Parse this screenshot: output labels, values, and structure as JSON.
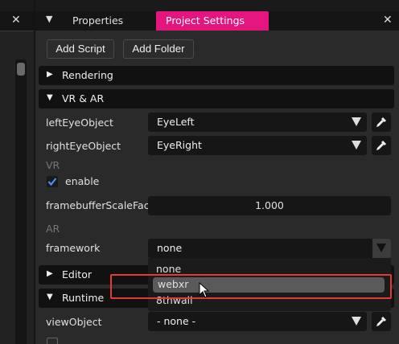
{
  "tabs": {
    "properties": "Properties",
    "project_settings": "Project Settings"
  },
  "toolbar": {
    "add_script": "Add Script",
    "add_folder": "Add Folder"
  },
  "sections": {
    "rendering": "Rendering",
    "vr_ar": "VR & AR",
    "editor": "Editor",
    "runtime": "Runtime"
  },
  "vr_ar": {
    "left_eye_label": "leftEyeObject",
    "left_eye_value": "EyeLeft",
    "right_eye_label": "rightEyeObject",
    "right_eye_value": "EyeRight",
    "vr_header": "VR",
    "enable_label": "enable",
    "enable_checked": true,
    "framebuffer_label": "framebufferScaleFactor",
    "framebuffer_value": "1.000",
    "ar_header": "AR",
    "framework_label": "framework",
    "framework_value": "none",
    "framework_options": [
      "none",
      "webxr",
      "8thwall"
    ],
    "highlighted_option": "webxr"
  },
  "runtime": {
    "view_object_label": "viewObject",
    "view_object_value": "- none -"
  },
  "icons": {
    "tab_close": "close-icon",
    "menu": "menu-icon",
    "picker": "eyedropper-icon",
    "caret": "chevron-down-icon",
    "expand": "triangle-right-icon",
    "collapse": "triangle-down-icon"
  },
  "colors": {
    "accent": "#e5157f",
    "highlight_box": "#e53935",
    "panel_bg": "#2a2a2a",
    "section_bg": "#111111"
  }
}
